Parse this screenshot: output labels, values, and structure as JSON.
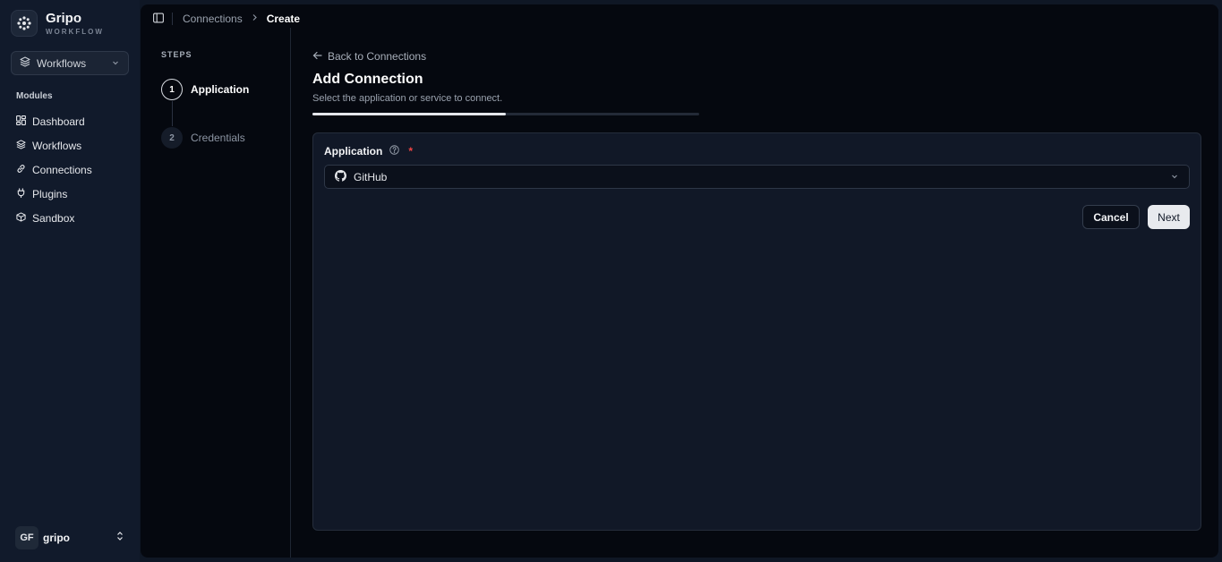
{
  "brand": {
    "name": "Gripo",
    "subtitle": "WORKFLOW"
  },
  "workspace_select": {
    "value": "Workflows"
  },
  "sidebar": {
    "section_label": "Modules",
    "items": [
      {
        "label": "Dashboard",
        "icon": "dashboard-icon"
      },
      {
        "label": "Workflows",
        "icon": "layers-icon"
      },
      {
        "label": "Connections",
        "icon": "link-icon"
      },
      {
        "label": "Plugins",
        "icon": "plug-icon"
      },
      {
        "label": "Sandbox",
        "icon": "box-icon"
      }
    ]
  },
  "user": {
    "initials": "GF",
    "name": "gripo"
  },
  "breadcrumb": {
    "parent": "Connections",
    "current": "Create"
  },
  "steps": {
    "label": "STEPS",
    "items": [
      {
        "number": "1",
        "label": "Application",
        "active": true
      },
      {
        "number": "2",
        "label": "Credentials",
        "active": false
      }
    ]
  },
  "content": {
    "back_label": "Back to Connections",
    "title": "Add Connection",
    "subtitle": "Select the application or service to connect.",
    "progress": 0.5
  },
  "form": {
    "field_label": "Application",
    "required_mark": "*",
    "selected_app": "GitHub",
    "cancel_label": "Cancel",
    "next_label": "Next"
  },
  "colors": {
    "accent": "#e5e7eb",
    "required": "#ef4444",
    "sidebar_bg": "#111a2b",
    "main_bg": "#05080f",
    "card_bg": "#111827"
  }
}
